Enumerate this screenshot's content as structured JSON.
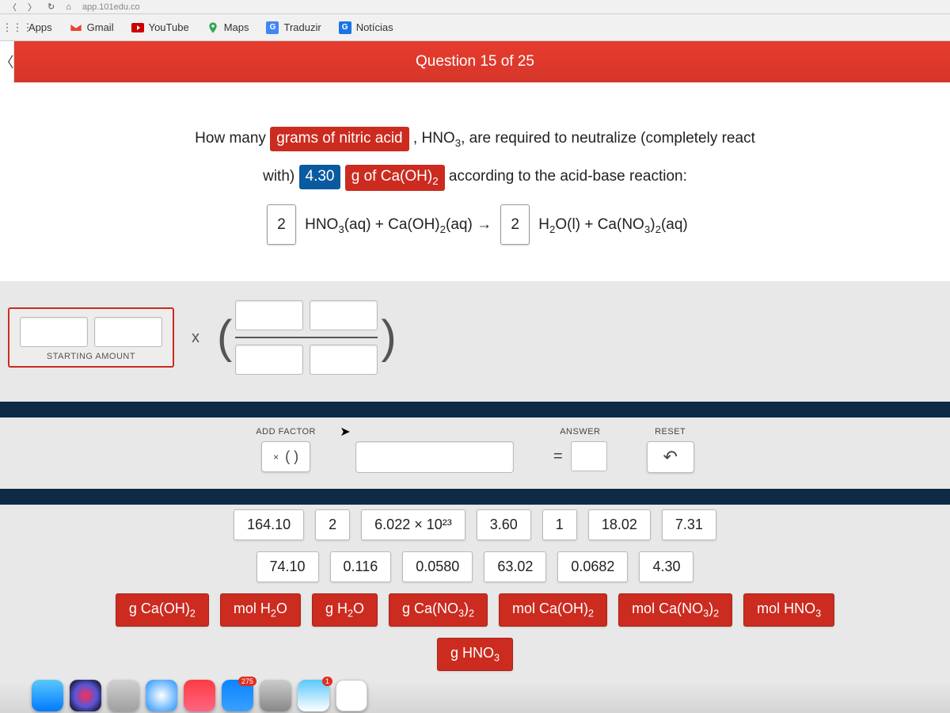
{
  "browser": {
    "url_fragment": "app.101edu.co",
    "bookmarks_label": "Apps",
    "bookmarks": [
      {
        "label": "Gmail",
        "icon": "gmail-icon"
      },
      {
        "label": "YouTube",
        "icon": "youtube-icon"
      },
      {
        "label": "Maps",
        "icon": "maps-icon"
      },
      {
        "label": "Traduzir",
        "icon": "translate-icon"
      },
      {
        "label": "Notícias",
        "icon": "news-icon"
      }
    ]
  },
  "header": {
    "question_progress": "Question 15 of 25"
  },
  "question": {
    "pre_chip1": "How many",
    "chip1": "grams of nitric acid",
    "mid1": ", HNO₃, are required to neutralize (completely react",
    "line2_pre": "with)",
    "chip_value": "4.30",
    "chip2": "g of Ca(OH)₂",
    "line2_post": "according to the acid-base reaction:",
    "coef1": "2",
    "eq_left": "HNO₃(aq) + Ca(OH)₂(aq) →",
    "coef2": "2",
    "eq_right": "H₂O(l) + Ca(NO₃)₂(aq)"
  },
  "work": {
    "starting_label": "STARTING AMOUNT",
    "multiply": "x"
  },
  "controls": {
    "add_factor_label": "ADD FACTOR",
    "add_factor_button": "(   )",
    "add_factor_prefix": "×",
    "answer_label": "ANSWER",
    "equals": "=",
    "reset_label": "RESET",
    "reset_glyph": "↶"
  },
  "tiles": {
    "row1": [
      "164.10",
      "2",
      "6.022 × 10²³",
      "3.60",
      "1",
      "18.02",
      "7.31"
    ],
    "row2": [
      "74.10",
      "0.116",
      "0.0580",
      "63.02",
      "0.0682",
      "4.30"
    ],
    "row3": [
      "g Ca(OH)₂",
      "mol H₂O",
      "g H₂O",
      "g Ca(NO₃)₂",
      "mol Ca(OH)₂",
      "mol Ca(NO₃)₂",
      "mol HNO₃"
    ],
    "row4": [
      "g HNO₃"
    ]
  },
  "dock": {
    "items": [
      {
        "name": "finder",
        "color": "#1e90ff"
      },
      {
        "name": "siri",
        "color": "#222"
      },
      {
        "name": "launchpad",
        "color": "#888"
      },
      {
        "name": "safari",
        "color": "#2aa0e0"
      },
      {
        "name": "music",
        "color": "#fc3c44",
        "badge": ""
      },
      {
        "name": "app-store",
        "color": "#0b84ff",
        "badge": "275"
      },
      {
        "name": "settings",
        "color": "#888"
      },
      {
        "name": "mail",
        "color": "#3da9f5",
        "badge": "1"
      },
      {
        "name": "calendar",
        "color": "#fff"
      }
    ]
  }
}
